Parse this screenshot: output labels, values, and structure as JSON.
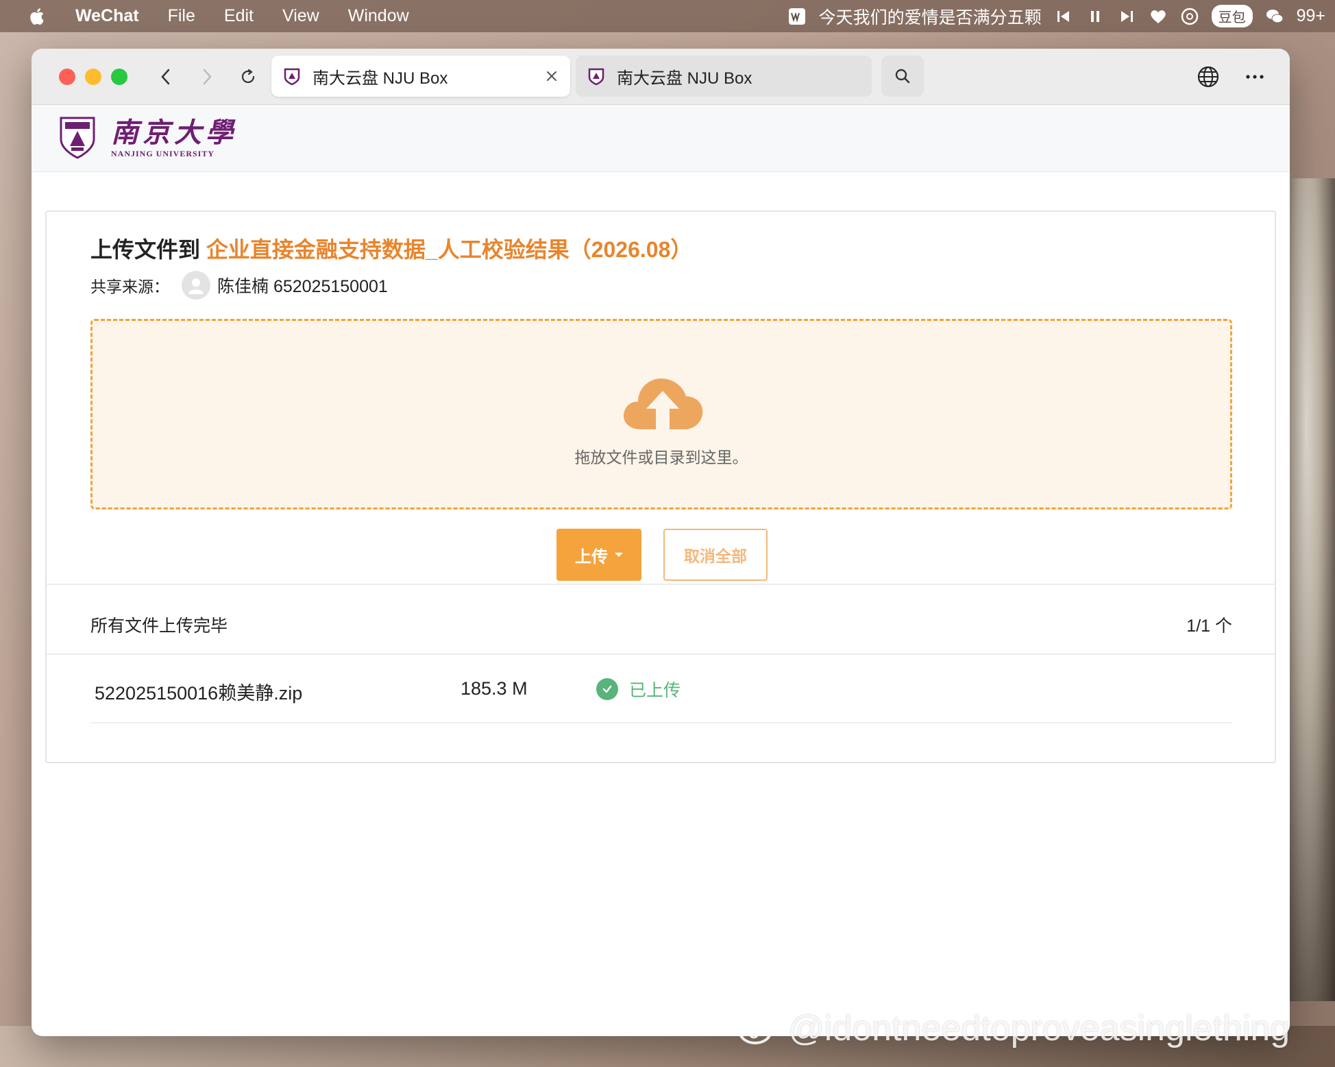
{
  "menubar": {
    "app_name": "WeChat",
    "items": [
      "File",
      "Edit",
      "View",
      "Window"
    ],
    "now_playing": "今天我们的爱情是否满分五颗",
    "doubao_label": "豆包",
    "wechat_badge": "99+"
  },
  "browser": {
    "tabs": [
      {
        "title": "南大云盘 NJU Box"
      },
      {
        "title": "南大云盘 NJU Box"
      }
    ]
  },
  "site": {
    "brand_cn": "南京大學",
    "brand_en": "NANJING UNIVERSITY"
  },
  "upload": {
    "title_prefix": "上传文件到 ",
    "folder_name": "企业直接金融支持数据_人工校验结果（2026.08）",
    "share_label": "共享来源：",
    "owner": "陈佳楠 652025150001",
    "drop_hint": "拖放文件或目录到这里。",
    "upload_button": "上传",
    "cancel_all_button": "取消全部",
    "status_text": "所有文件上传完毕",
    "count_text": "1/1 个",
    "files": [
      {
        "name": "522025150016赖美静.zip",
        "size": "185.3 M",
        "status": "已上传"
      }
    ]
  },
  "colors": {
    "accent": "#f5a33c",
    "folder": "#e8852d",
    "success": "#59b37a",
    "brand": "#6d1f72"
  },
  "watermark": "@idontneedtoproveasinglething"
}
